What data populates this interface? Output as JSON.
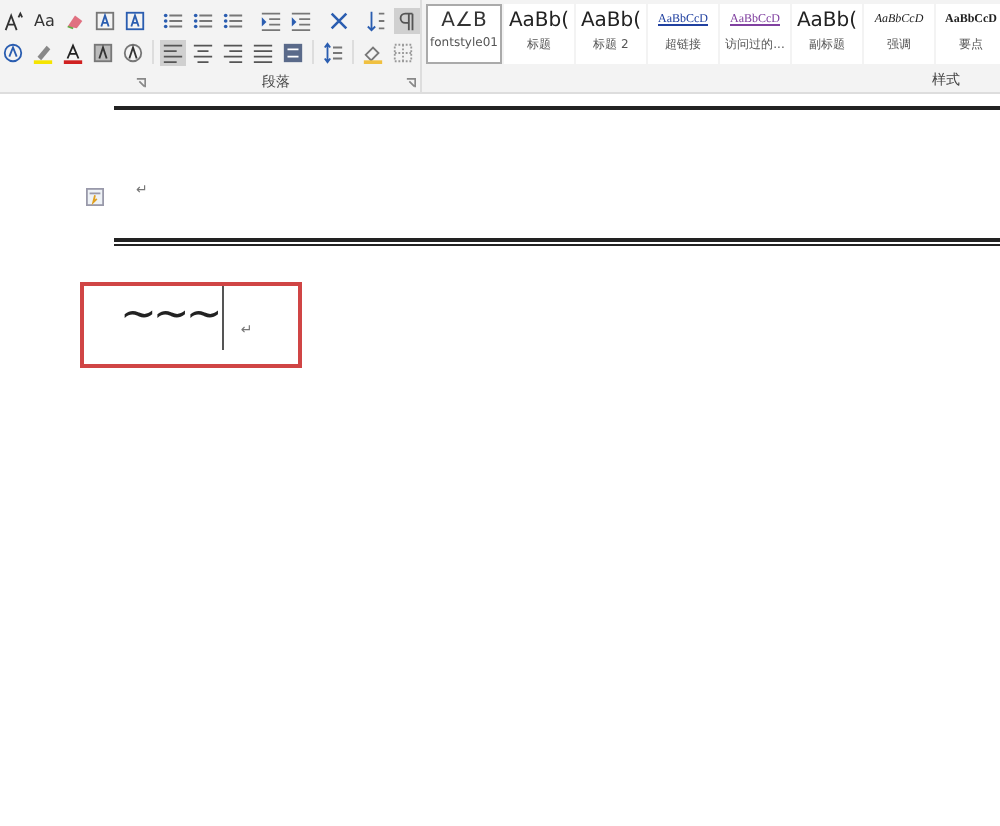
{
  "ribbon": {
    "case_button": "Aa",
    "paragraph_group": "段落",
    "styles_group": "样式",
    "styles": [
      {
        "kind": "shape",
        "preview": "A∠B",
        "name": "fontstyle01",
        "selected": true
      },
      {
        "kind": "heading",
        "preview": "AaBb(",
        "name": "标题",
        "selected": false
      },
      {
        "kind": "heading",
        "preview": "AaBb(",
        "name": "标题 2",
        "selected": false
      },
      {
        "kind": "link",
        "preview": "AaBbCcD",
        "name": "超链接",
        "selected": false
      },
      {
        "kind": "visited",
        "preview": "AaBbCcD",
        "name": "访问过的...",
        "selected": false
      },
      {
        "kind": "heading",
        "preview": "AaBb(",
        "name": "副标题",
        "selected": false
      },
      {
        "kind": "emphasis",
        "preview": "AaBbCcD",
        "name": "强调",
        "selected": false
      },
      {
        "kind": "strong",
        "preview": "AaBbCcD",
        "name": "要点",
        "selected": false
      }
    ]
  },
  "document": {
    "first_mark": "↵",
    "tilde_text": "~~~",
    "second_mark": "↵"
  }
}
